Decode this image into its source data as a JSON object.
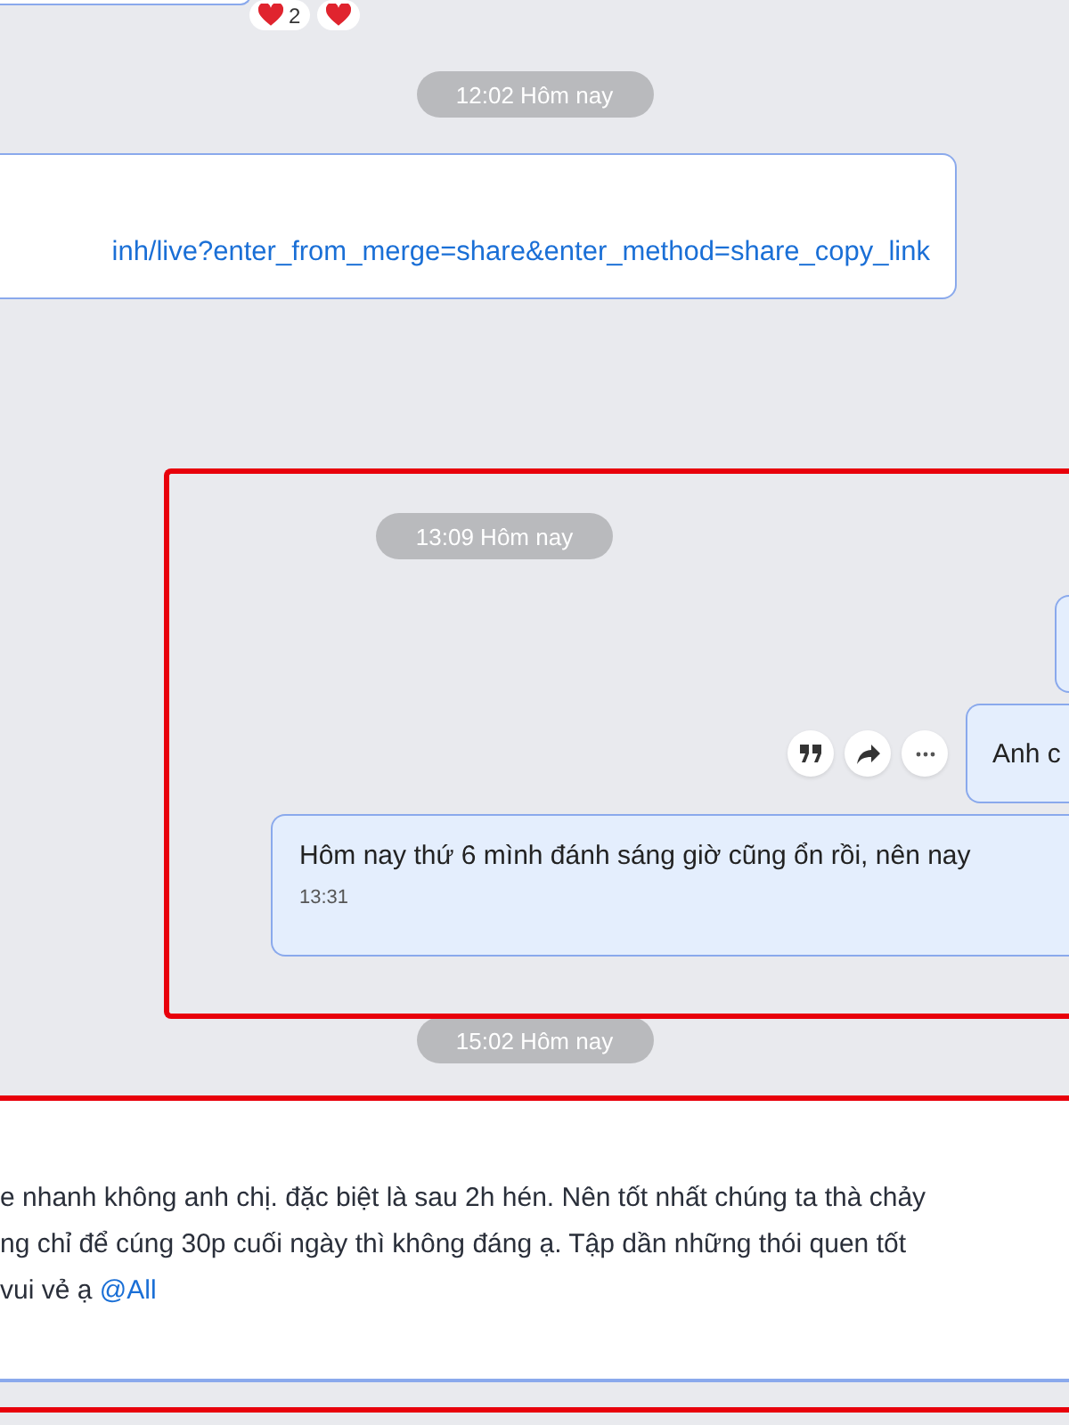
{
  "top_message": {
    "reactions": [
      {
        "kind": "heart",
        "count": "2"
      },
      {
        "kind": "heart"
      }
    ]
  },
  "time_divider_1": "12:02 Hôm nay",
  "link_message": {
    "url": "inh/live?enter_from_merge=share&enter_method=share_copy_link"
  },
  "highlighted_section": {
    "time_divider": "13:09 Hôm nay",
    "actions": [
      {
        "kind": "quote"
      },
      {
        "kind": "forward"
      },
      {
        "kind": "more"
      }
    ],
    "messages": [
      {
        "kind": "partial"
      },
      {
        "kind": "short",
        "text": "Anh c"
      },
      {
        "kind": "long",
        "text": "Hôm nay thứ 6 mình đánh sáng giờ cũng ổn rồi, nên nay",
        "time": "13:31"
      }
    ]
  },
  "time_divider_2": "15:02 Hôm nay",
  "last_message": {
    "lines": [
      "e nhanh không anh chị. đặc biệt là sau 2h hén. Nên tốt nhất chúng ta thà chảy",
      "ng chỉ để cúng 30p cuối ngày thì không đáng ạ. Tập dần những thói quen tốt",
      "vui vẻ ạ "
    ],
    "mention": "@All"
  }
}
